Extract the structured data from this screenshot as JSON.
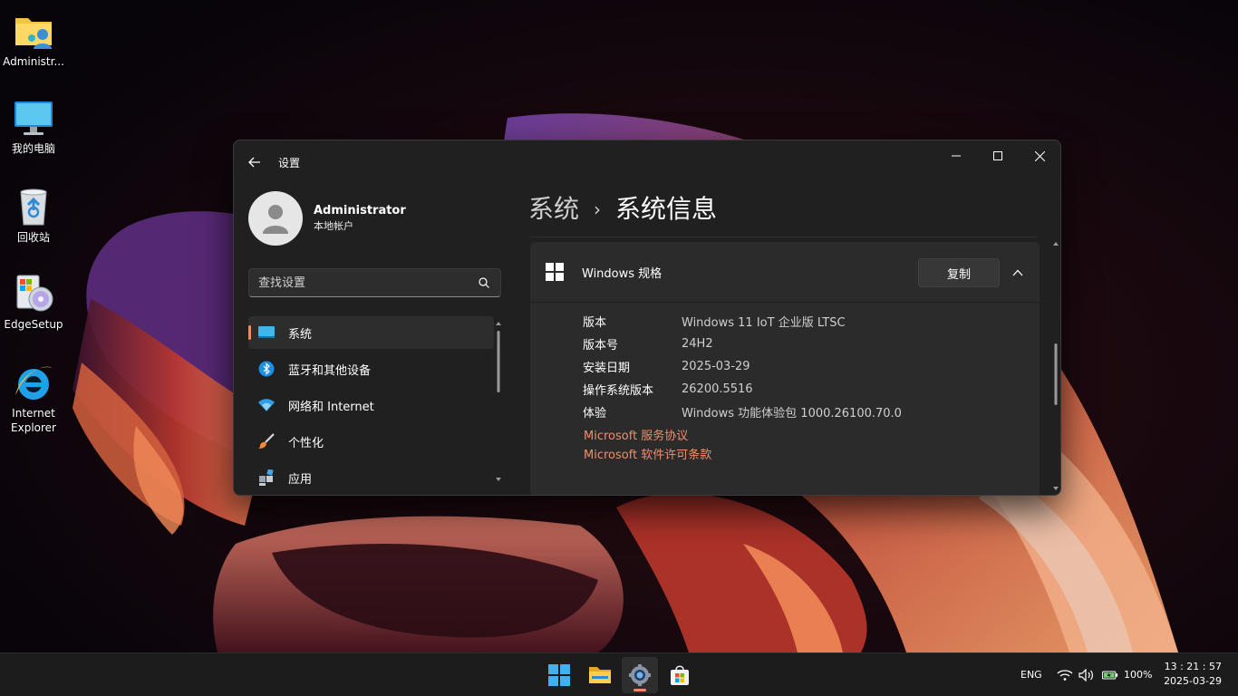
{
  "desktop": {
    "icons": [
      {
        "label": "Administr..."
      },
      {
        "label": "我的电脑"
      },
      {
        "label": "回收站"
      },
      {
        "label": "EdgeSetup"
      },
      {
        "label": "Internet Explorer"
      }
    ]
  },
  "window": {
    "title": "设置",
    "profile": {
      "name": "Administrator",
      "subtitle": "本地帐户"
    },
    "search": {
      "placeholder": "查找设置"
    },
    "nav": [
      {
        "label": "系统",
        "icon": "system-monitor-icon",
        "active": true
      },
      {
        "label": "蓝牙和其他设备",
        "icon": "bluetooth-icon"
      },
      {
        "label": "网络和 Internet",
        "icon": "wifi-icon"
      },
      {
        "label": "个性化",
        "icon": "paintbrush-icon"
      },
      {
        "label": "应用",
        "icon": "apps-icon"
      }
    ],
    "breadcrumb": {
      "parent": "系统",
      "separator": "›",
      "current": "系统信息"
    },
    "card": {
      "title": "Windows 规格",
      "copy_label": "复制",
      "specs": [
        {
          "key": "版本",
          "value": "Windows 11 IoT 企业版 LTSC"
        },
        {
          "key": "版本号",
          "value": "24H2"
        },
        {
          "key": "安装日期",
          "value": "2025-03-29"
        },
        {
          "key": "操作系统版本",
          "value": "26200.5516"
        },
        {
          "key": "体验",
          "value": "Windows 功能体验包 1000.26100.70.0"
        }
      ],
      "links": [
        "Microsoft 服务协议",
        "Microsoft 软件许可条款"
      ]
    }
  },
  "taskbar": {
    "language": "ENG",
    "battery": "100%",
    "time": "13 : 21 : 57",
    "date": "2025-03-29"
  },
  "colors": {
    "accent": "#ef8a6b",
    "link": "#ef8f6f",
    "window_bg": "#202020",
    "card_bg": "#2b2b2b",
    "taskbar_bg": "#1c1c1c"
  }
}
